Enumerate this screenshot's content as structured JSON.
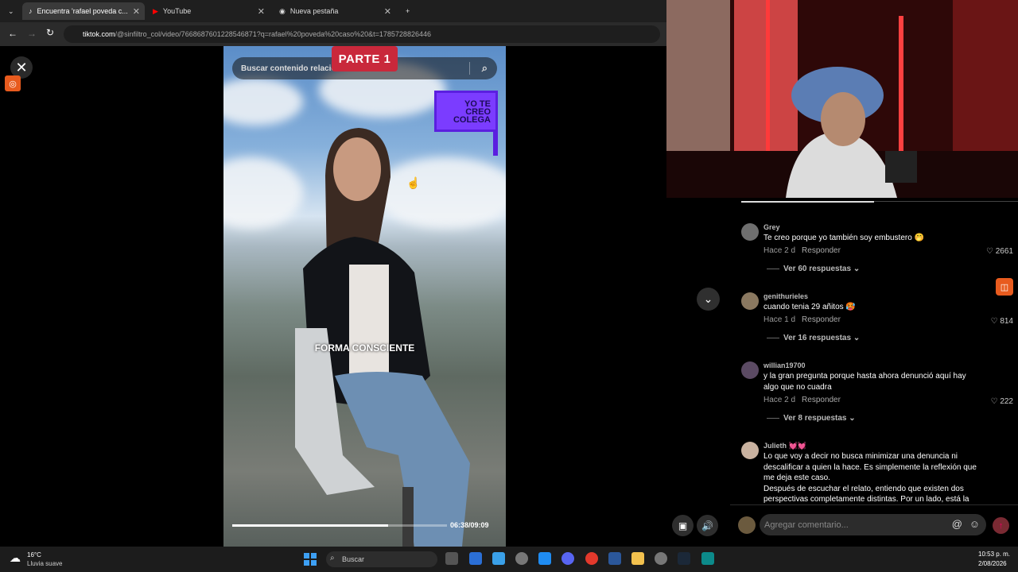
{
  "browser": {
    "tabs": [
      {
        "label": "Encuentra 'rafael poveda c...",
        "active": true
      },
      {
        "label": "YouTube",
        "active": false
      },
      {
        "label": "Nueva pestaña",
        "active": false
      }
    ],
    "url_domain": "tiktok.com",
    "url_path": "/@sinfiltro_col/video/7668687601228546871?q=rafael%20poveda%20caso%20&t=1785728826446"
  },
  "video": {
    "search_placeholder": "Buscar contenido relacionado",
    "parte_label": "PARTE 1",
    "overlay_logo": [
      "YO TE",
      "CREO",
      "COLEGA"
    ],
    "caption": "FORMA CONSCIENTE",
    "time": "06:38/09:09",
    "progress": 0.727
  },
  "comments": [
    {
      "user": "Grey",
      "text": "Te creo porque yo también soy embustero 🤭",
      "age": "Hace 2 d",
      "reply_label": "Responder",
      "likes": "2661",
      "replies": "Ver 60 respuestas",
      "avatar_color": "#6f6f6f"
    },
    {
      "user": "genithurieles",
      "text": "cuando tenia 29 añitos 🥵",
      "age": "Hace 1 d",
      "reply_label": "Responder",
      "likes": "814",
      "replies": "Ver 16 respuestas",
      "avatar_color": "#8a7860"
    },
    {
      "user": "willian19700",
      "text": "y la gran pregunta porque hasta ahora denunció aquí hay algo que no cuadra",
      "age": "Hace 2 d",
      "reply_label": "Responder",
      "likes": "222",
      "replies": "Ver 8 respuestas",
      "avatar_color": "#5b4a63"
    },
    {
      "user": "Julieth 💓💓",
      "text": "Lo que voy a decir no busca minimizar una denuncia ni descalificar a quien la hace. Es simplemente la reflexión que me deja este caso.\nDespués de escuchar el relato, entiendo que existen dos perspectivas completamente distintas. Por un lado, está la",
      "avatar_color": "#c9b2a0"
    }
  ],
  "comment_input_placeholder": "Agregar comentario...",
  "taskbar": {
    "weather_temp": "16°C",
    "weather_desc": "Lluvia suave",
    "search_label": "Buscar",
    "time": "10:53 p. m.",
    "date": "2/08/2026"
  },
  "colors": {
    "accent": "#fe2c55",
    "panel_bg": "#000000",
    "tiktok_overlay": "#7b3cff"
  }
}
